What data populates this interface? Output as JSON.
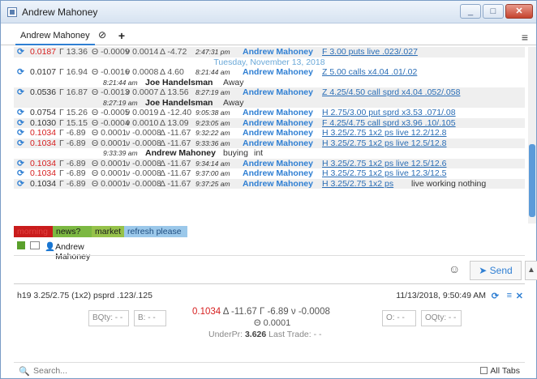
{
  "window": {
    "title": "Andrew Mahoney",
    "buttons": [
      "_",
      "□",
      "✕"
    ]
  },
  "tabs": [
    {
      "label": "Andrew Mahoney"
    }
  ],
  "tab_close_symbol": "⊘",
  "tab_add_symbol": "+",
  "feed": {
    "r1": {
      "price": "0.0187",
      "gamma": "Γ 13.36",
      "theta": "Θ -0.0009",
      "vega": "ν 0.0014",
      "delta": "Δ -4.72",
      "time": "2:47:31 pm",
      "who": "Andrew Mahoney",
      "msg": "F 3.00 puts live .023/.027"
    },
    "date": "Tuesday, November 13, 2018",
    "r2": {
      "price": "0.0107",
      "gamma": "Γ 16.94",
      "theta": "Θ -0.0016",
      "vega": "ν 0.0008",
      "delta": "Δ 4.60",
      "time": "8:21:44 am",
      "who": "Andrew Mahoney",
      "msg": "Z 5.00 calls x4.04 .01/.02"
    },
    "s1": {
      "time": "8:21:44 am",
      "who": "Joe Handelsman",
      "status": "Away"
    },
    "r3": {
      "price": "0.0536",
      "gamma": "Γ 16.87",
      "theta": "Θ -0.0013",
      "vega": "ν 0.0007",
      "delta": "Δ 13.56",
      "time": "8:27:19 am",
      "who": "Andrew Mahoney",
      "msg": "Z 4.25/4.50 call sprd x4.04 .052/.058"
    },
    "s2": {
      "time": "8:27:19 am",
      "who": "Joe Handelsman",
      "status": "Away"
    },
    "r4": {
      "price": "0.0754",
      "gamma": "Γ 15.26",
      "theta": "Θ -0.0005",
      "vega": "ν 0.0019",
      "delta": "Δ -12.40",
      "time": "9:05:38 am",
      "who": "Andrew Mahoney",
      "msg": "H 2.75/3.00 put sprd x3.53 .071/.08"
    },
    "r5": {
      "price": "0.1030",
      "gamma": "Γ 15.15",
      "theta": "Θ -0.0004",
      "vega": "ν 0.0010",
      "delta": "Δ 13.09",
      "time": "9:23:05 am",
      "who": "Andrew Mahoney",
      "msg": "F 4.25/4.75 call sprd x3.96 .10/.105"
    },
    "r6": {
      "price": "0.1034",
      "gamma": "Γ -6.89",
      "theta": "Θ 0.0001",
      "vega": "ν -0.0008",
      "delta": "Δ -11.67",
      "time": "9:32:22 am",
      "who": "Andrew Mahoney",
      "msg": "H 3.25/2.75 1x2 ps live 12.2/12.8"
    },
    "r7": {
      "price": "0.1034",
      "gamma": "Γ -6.89",
      "theta": "Θ 0.0001",
      "vega": "ν -0.0008",
      "delta": "Δ -11.67",
      "time": "9:33:36 am",
      "who": "Andrew Mahoney",
      "msg": "H 3.25/2.75 1x2 ps live 12.5/12.8"
    },
    "s3": {
      "time": "9:33:39 am",
      "who": "Andrew Mahoney",
      "buying": "buying",
      "rest": "int"
    },
    "r8": {
      "price": "0.1034",
      "gamma": "Γ -6.89",
      "theta": "Θ 0.0001",
      "vega": "ν -0.0008",
      "delta": "Δ -11.67",
      "time": "9:34:14 am",
      "who": "Andrew Mahoney",
      "msg": "H 3.25/2.75 1x2 ps live 12.5/12.6"
    },
    "r9": {
      "price": "0.1034",
      "gamma": "Γ -6.89",
      "theta": "Θ 0.0001",
      "vega": "ν -0.0008",
      "delta": "Δ -11.67",
      "time": "9:37:00 am",
      "who": "Andrew Mahoney",
      "msg": "H 3.25/2.75 1x2 ps live 12.3/12.5"
    },
    "r10": {
      "price": "0.1034",
      "gamma": "Γ -6.89",
      "theta": "Θ 0.0001",
      "vega": "ν -0.0008",
      "delta": "Δ -11.67",
      "time": "9:37:25 am",
      "who": "Andrew Mahoney",
      "msg": "H 3.25/2.75 1x2 ps",
      "msg_tail": "live working nothing"
    }
  },
  "tags": [
    "morning",
    "news?",
    "market",
    "refresh please"
  ],
  "participants": {
    "user": "Andrew Mahoney"
  },
  "composer": {
    "send_label": "Send"
  },
  "quote": {
    "symbol": "h19 3.25/2.75 (1x2) psprd .123/.125",
    "timestamp": "11/13/2018, 9:50:49 AM",
    "bqty": "BQty: - -",
    "b": "B: - -",
    "o": "O: - -",
    "oqty": "OQty: - -",
    "price": "0.1034",
    "delta": "Δ -11.67",
    "gamma": "Γ -6.89",
    "vega": "ν -0.0008",
    "theta": "Θ 0.0001",
    "under_label": "UnderPr:",
    "under_value": "3.626",
    "last_trade": "Last Trade: - -"
  },
  "search": {
    "placeholder": "Search...",
    "all_tabs": "All Tabs"
  },
  "colors": {
    "accent": "#2f7fd3",
    "price_red": "#d61f1f",
    "tag_morning": "#c91c1c",
    "tag_news": "#7cb842",
    "tag_market": "#96c24a",
    "tag_refresh": "#9bc8ea"
  }
}
